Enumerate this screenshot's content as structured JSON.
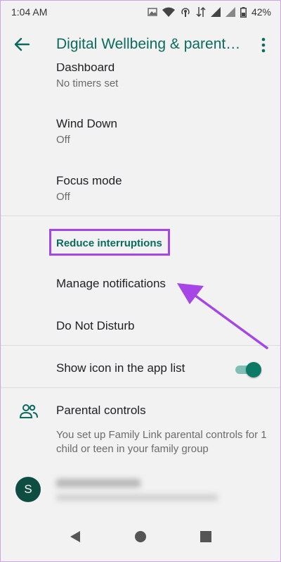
{
  "status_bar": {
    "time": "1:04 AM",
    "battery": "42%"
  },
  "app_bar": {
    "title": "Digital Wellbeing & parental controls"
  },
  "items": {
    "dashboard": {
      "title": "Dashboard",
      "subtitle": "No timers set"
    },
    "wind_down": {
      "title": "Wind Down",
      "subtitle": "Off"
    },
    "focus_mode": {
      "title": "Focus mode",
      "subtitle": "Off"
    }
  },
  "reduce_interruptions": {
    "header": "Reduce interruptions",
    "manage_notifications": "Manage notifications",
    "do_not_disturb": "Do Not Disturb"
  },
  "show_icon": {
    "label": "Show icon in the app list",
    "enabled": true
  },
  "parental_controls": {
    "title": "Parental controls",
    "description": "You set up Family Link parental controls for 1 child or teen in your family group",
    "avatar_letter": "S"
  },
  "colors": {
    "accent": "#0a6b5e",
    "highlight": "#a646e6"
  }
}
